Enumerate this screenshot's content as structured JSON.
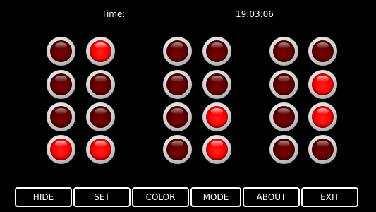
{
  "header": {
    "time_label": "Time:",
    "time_value": "19:03:06"
  },
  "clock": {
    "led_color_on": "#ff0000",
    "led_color_off": "#5a0000",
    "rows": [
      [
        false,
        true,
        false,
        false,
        false,
        false
      ],
      [
        false,
        false,
        false,
        false,
        false,
        true
      ],
      [
        false,
        false,
        false,
        true,
        false,
        true
      ],
      [
        true,
        true,
        false,
        true,
        false,
        false
      ]
    ]
  },
  "toolbar": {
    "hide_label": "HIDE",
    "set_label": "SET",
    "color_label": "COLOR",
    "mode_label": "MODE",
    "about_label": "ABOUT",
    "exit_label": "EXIT"
  }
}
